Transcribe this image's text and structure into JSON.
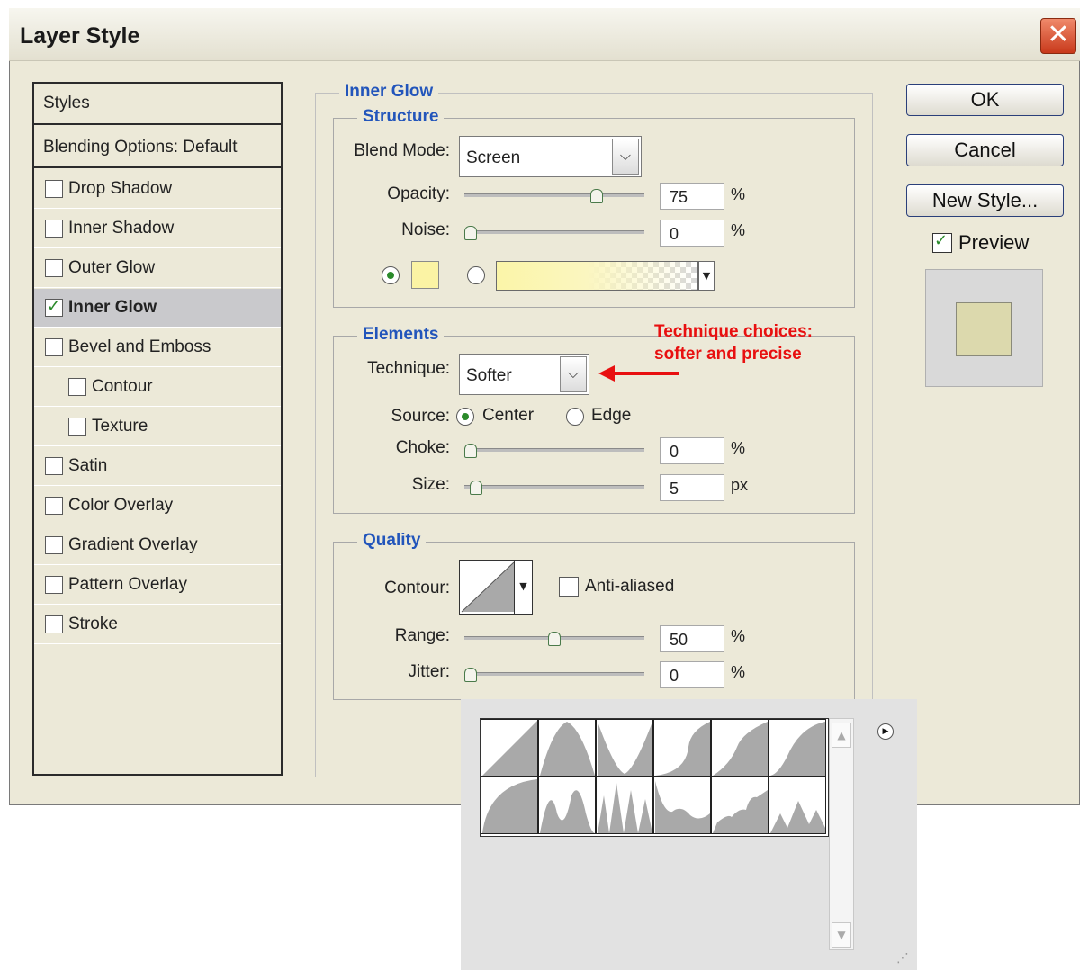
{
  "window": {
    "title": "Layer Style",
    "close_symbol": "✕"
  },
  "styles_panel": {
    "header": "Styles",
    "blending": "Blending Options: Default",
    "items": [
      {
        "label": "Drop Shadow",
        "checked": false
      },
      {
        "label": "Inner Shadow",
        "checked": false
      },
      {
        "label": "Outer Glow",
        "checked": false
      },
      {
        "label": "Inner Glow",
        "checked": true
      },
      {
        "label": "Bevel and Emboss",
        "checked": false
      },
      {
        "label": "Contour",
        "checked": false
      },
      {
        "label": "Texture",
        "checked": false
      },
      {
        "label": "Satin",
        "checked": false
      },
      {
        "label": "Color Overlay",
        "checked": false
      },
      {
        "label": "Gradient Overlay",
        "checked": false
      },
      {
        "label": "Pattern Overlay",
        "checked": false
      },
      {
        "label": "Stroke",
        "checked": false
      }
    ]
  },
  "inner_glow": {
    "title": "Inner Glow",
    "structure": {
      "title": "Structure",
      "blend_mode_label": "Blend Mode:",
      "blend_mode_value": "Screen",
      "opacity_label": "Opacity:",
      "opacity_value": "75",
      "opacity_percent": 75,
      "opacity_unit": "%",
      "noise_label": "Noise:",
      "noise_value": "0",
      "noise_percent": 0,
      "noise_unit": "%",
      "glow_color": "#fbf3a4"
    },
    "elements": {
      "title": "Elements",
      "technique_label": "Technique:",
      "technique_value": "Softer",
      "source_label": "Source:",
      "source_center": "Center",
      "source_edge": "Edge",
      "choke_label": "Choke:",
      "choke_value": "0",
      "choke_percent": 0,
      "choke_unit": "%",
      "size_label": "Size:",
      "size_value": "5",
      "size_unit": "px"
    },
    "quality": {
      "title": "Quality",
      "contour_label": "Contour:",
      "anti_aliased_label": "Anti-aliased",
      "range_label": "Range:",
      "range_value": "50",
      "range_percent": 50,
      "range_unit": "%",
      "jitter_label": "Jitter:",
      "jitter_value": "0",
      "jitter_percent": 0,
      "jitter_unit": "%"
    }
  },
  "buttons": {
    "ok": "OK",
    "cancel": "Cancel",
    "new_style": "New Style...",
    "preview": "Preview"
  },
  "annotation": {
    "line1": "Technique choices:",
    "line2": "softer and precise"
  },
  "colors": {
    "accent_blue": "#2255bb",
    "annotation_red": "#e81010",
    "preview_swatch": "#dcd9ad"
  }
}
